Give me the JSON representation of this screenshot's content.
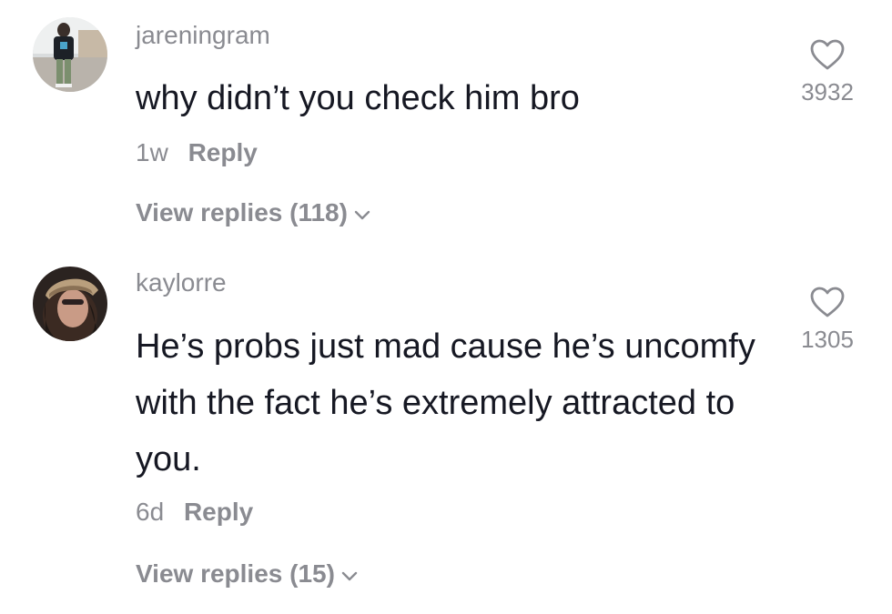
{
  "comments": [
    {
      "username": "jareningram",
      "text": "why didn’t you check him bro",
      "age": "1w",
      "reply_label": "Reply",
      "view_replies": "View replies (118)",
      "likes": "3932"
    },
    {
      "username": "kaylorre",
      "text": "He’s probs just mad cause he’s uncomfy with the fact he’s extremely attracted to you.",
      "age": "6d",
      "reply_label": "Reply",
      "view_replies": "View replies (15)",
      "likes": "1305"
    }
  ],
  "colors": {
    "text": "#161823",
    "secondary": "#8a8b91",
    "background": "#ffffff"
  },
  "icons": {
    "like": "heart-outline-icon",
    "expand": "chevron-down-icon"
  }
}
